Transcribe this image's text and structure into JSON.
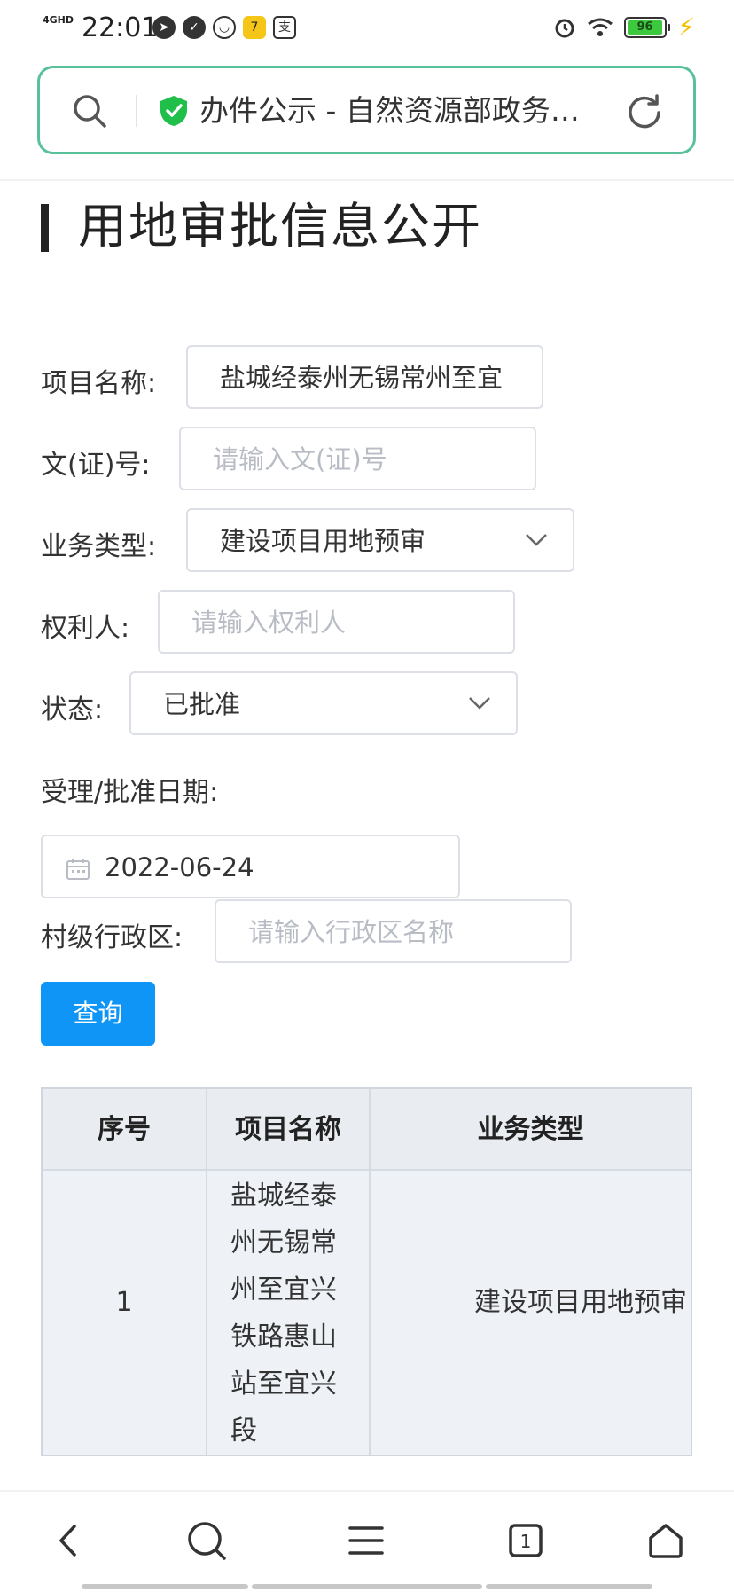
{
  "status_bar": {
    "network": "4GHD",
    "time": "22:01",
    "notification_icons": [
      "compass-icon",
      "check-icon",
      "mask-icon",
      "app-icon",
      "pay-icon"
    ],
    "battery": "96"
  },
  "browser": {
    "tab_title": "办件公示 - 自然资源部政务…"
  },
  "page": {
    "title": "用地审批信息公开"
  },
  "form": {
    "project_name_label": "项目名称:",
    "project_name_value": "盐城经泰州无锡常州至宜",
    "doc_no_label": "文(证)号:",
    "doc_no_placeholder": "请输入文(证)号",
    "biz_type_label": "业务类型:",
    "biz_type_value": "建设项目用地预审",
    "owner_label": "权利人:",
    "owner_placeholder": "请输入权利人",
    "status_label": "状态:",
    "status_value": "已批准",
    "date_label": "受理/批准日期:",
    "date_value": "2022-06-24",
    "village_label": "村级行政区:",
    "village_placeholder": "请输入行政区名称",
    "query_button": "查询"
  },
  "table": {
    "headers": [
      "序号",
      "项目名称",
      "业务类型"
    ],
    "rows": [
      {
        "index": "1",
        "project_name_lines": [
          "盐城经泰",
          "州无锡常",
          "州至宜兴",
          "铁路惠山",
          "站至宜兴",
          "段"
        ],
        "biz_type": "建设项目用地预审"
      }
    ]
  },
  "colors": {
    "address_border": "#59c19a",
    "primary_button": "#0f95f5",
    "shield": "#1fbf4a"
  }
}
